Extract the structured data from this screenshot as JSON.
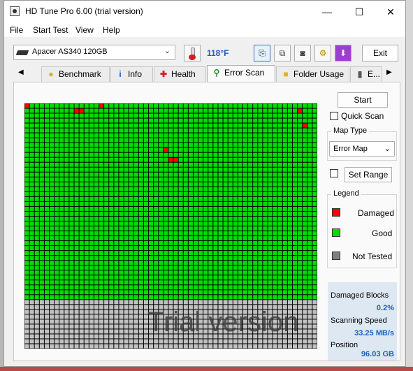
{
  "window": {
    "title": "HD Tune Pro 6.00 (trial version)",
    "controls": {
      "minimize": "—",
      "maximize": "☐",
      "close": "✕"
    }
  },
  "menu": [
    "File",
    "Start Test",
    "View",
    "Help"
  ],
  "toolbar": {
    "drive": "Apacer AS340 120GB",
    "temperature": "118°F",
    "exit_label": "Exit",
    "buttons": [
      {
        "name": "copy-text-icon",
        "glyph": "⎘"
      },
      {
        "name": "copy-screenshot-icon",
        "glyph": "⧉"
      },
      {
        "name": "camera-icon",
        "glyph": "◙"
      },
      {
        "name": "options-icon",
        "glyph": "⚙"
      },
      {
        "name": "save-download-icon",
        "glyph": "⬇"
      }
    ]
  },
  "tabs": [
    {
      "label": "Benchmark",
      "icon": "benchmark-icon",
      "glyph": "●",
      "color": "#d8b000"
    },
    {
      "label": "Info",
      "icon": "info-icon",
      "glyph": "i",
      "color": "#1f5fbf"
    },
    {
      "label": "Health",
      "icon": "health-icon",
      "glyph": "✚",
      "color": "#d02020"
    },
    {
      "label": "Error Scan",
      "icon": "search-icon",
      "glyph": "⚲",
      "color": "#2a8a2a",
      "active": true
    },
    {
      "label": "Folder Usage",
      "icon": "folder-icon",
      "glyph": "■",
      "color": "#e0b030"
    },
    {
      "label": "E...",
      "icon": "erase-icon",
      "glyph": "▮",
      "color": "#555555"
    }
  ],
  "scan": {
    "start_label": "Start",
    "quick_scan_label": "Quick Scan",
    "map_type_title": "Map Type",
    "map_type_value": "Error Map",
    "set_range_label": "Set Range",
    "legend_title": "Legend",
    "legend": [
      {
        "label": "Damaged",
        "color": "#ff0000"
      },
      {
        "label": "Good",
        "color": "#00dd00"
      },
      {
        "label": "Not Tested",
        "color": "#808080"
      }
    ],
    "stats": {
      "damaged_label": "Damaged Blocks",
      "damaged_value": "0.2%",
      "speed_label": "Scanning Speed",
      "speed_value": "33.25 MB/s",
      "position_label": "Position",
      "position_value": "96.03 GB"
    },
    "watermark": "Trial version",
    "grid": {
      "columns": 59,
      "rows": 50,
      "good_rows": 40,
      "damaged_cells": [
        [
          0,
          0
        ],
        [
          10,
          1
        ],
        [
          11,
          1
        ],
        [
          15,
          0
        ],
        [
          55,
          1
        ],
        [
          56,
          4
        ],
        [
          28,
          9
        ],
        [
          29,
          11
        ],
        [
          30,
          11
        ]
      ],
      "colors": {
        "good": "#00dd00",
        "damaged": "#ff0000",
        "not_tested": "#c0c0c0"
      }
    }
  }
}
